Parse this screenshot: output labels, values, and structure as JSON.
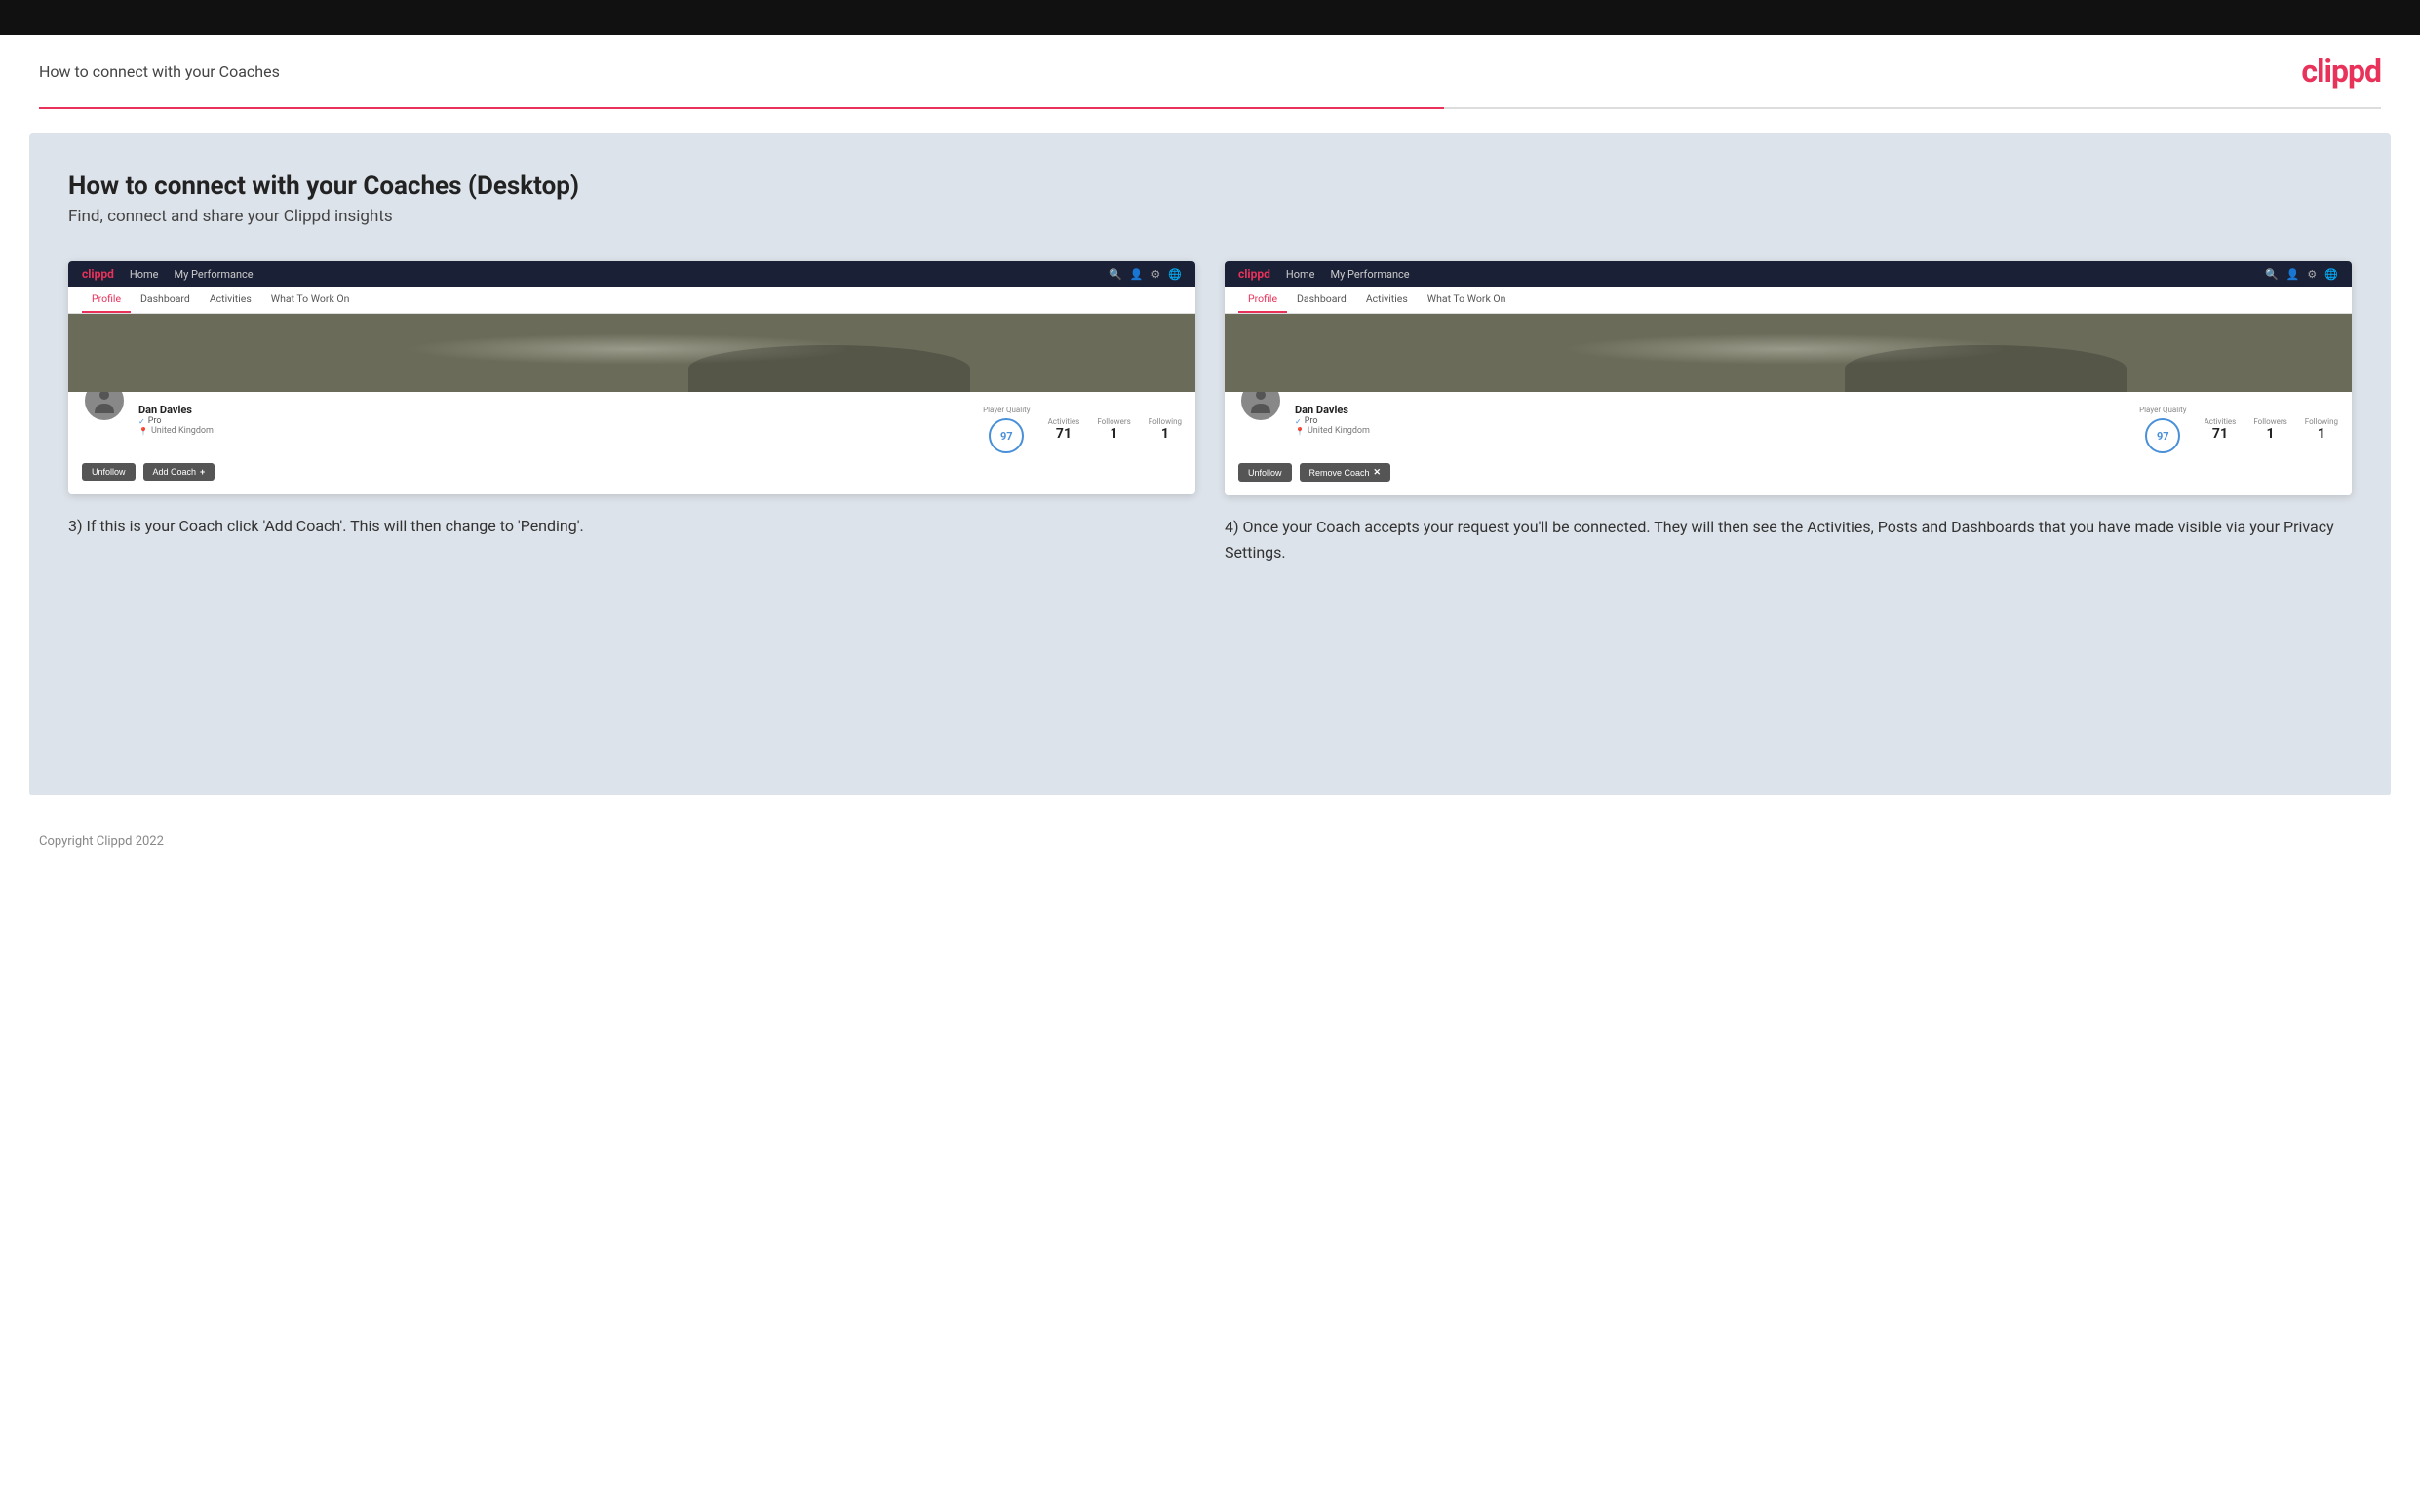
{
  "top_bar": {},
  "header": {
    "title": "How to connect with your Coaches",
    "logo": "clippd"
  },
  "main": {
    "heading": "How to connect with your Coaches (Desktop)",
    "subheading": "Find, connect and share your Clippd insights"
  },
  "screenshot_left": {
    "nav": {
      "logo": "clippd",
      "links": [
        "Home",
        "My Performance"
      ],
      "icons": [
        "search",
        "user",
        "settings",
        "globe"
      ]
    },
    "tabs": [
      "Profile",
      "Dashboard",
      "Activities",
      "What To Work On"
    ],
    "active_tab": "Profile",
    "user": {
      "name": "Dan Davies",
      "role": "Pro",
      "location": "United Kingdom",
      "player_quality_label": "Player Quality",
      "player_quality_value": "97",
      "activities_label": "Activities",
      "activities_value": "71",
      "followers_label": "Followers",
      "followers_value": "1",
      "following_label": "Following",
      "following_value": "1"
    },
    "buttons": {
      "unfollow": "Unfollow",
      "add_coach": "Add Coach"
    }
  },
  "screenshot_right": {
    "nav": {
      "logo": "clippd",
      "links": [
        "Home",
        "My Performance"
      ],
      "icons": [
        "search",
        "user",
        "settings",
        "globe"
      ]
    },
    "tabs": [
      "Profile",
      "Dashboard",
      "Activities",
      "What To Work On"
    ],
    "active_tab": "Profile",
    "user": {
      "name": "Dan Davies",
      "role": "Pro",
      "location": "United Kingdom",
      "player_quality_label": "Player Quality",
      "player_quality_value": "97",
      "activities_label": "Activities",
      "activities_value": "71",
      "followers_label": "Followers",
      "followers_value": "1",
      "following_label": "Following",
      "following_value": "1"
    },
    "buttons": {
      "unfollow": "Unfollow",
      "remove_coach": "Remove Coach"
    }
  },
  "captions": {
    "left": "3) If this is your Coach click 'Add Coach'. This will then change to 'Pending'.",
    "right": "4) Once your Coach accepts your request you'll be connected. They will then see the Activities, Posts and Dashboards that you have made visible via your Privacy Settings."
  },
  "footer": {
    "copyright": "Copyright Clippd 2022"
  }
}
